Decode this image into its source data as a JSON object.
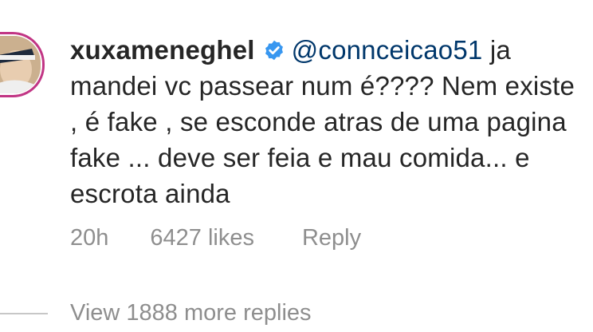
{
  "comment": {
    "username": "xuxameneghel",
    "verified_icon": "verified-badge-icon",
    "mention": "@connceicao51",
    "text_line1_tail": "ja",
    "text_rest": "mandei vc passear num é???? Nem existe , é fake , se esconde atras de uma pagina fake ... deve ser feia e mau comida... e escrota ainda"
  },
  "meta": {
    "time": "20h",
    "likes": "6427 likes",
    "reply_label": "Reply"
  },
  "thread": {
    "view_more": "View 1888 more replies"
  },
  "colors": {
    "mention": "#00376b",
    "verified": "#3897f0",
    "meta": "#8e8e8e"
  }
}
